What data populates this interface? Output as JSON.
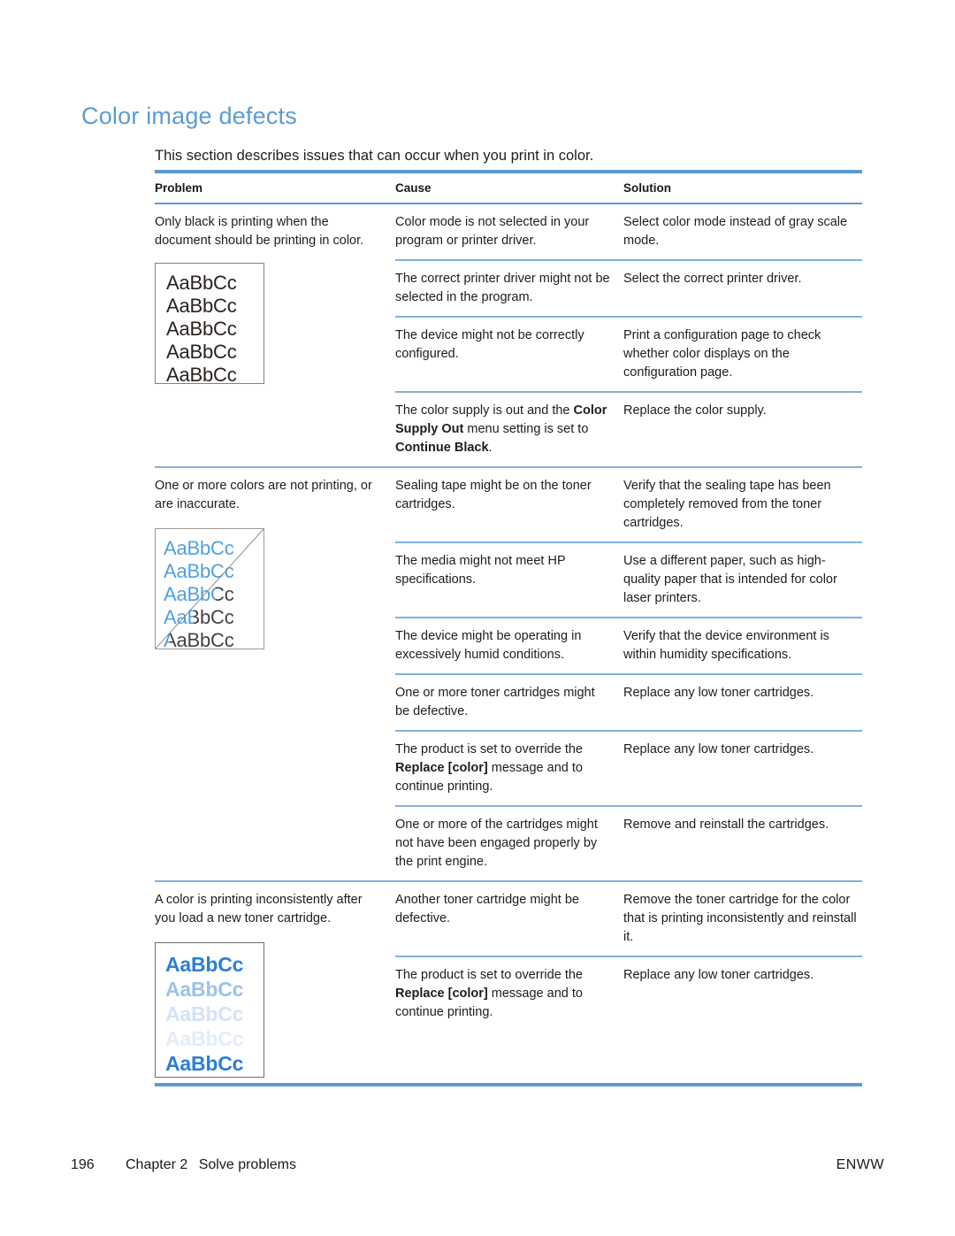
{
  "heading": "Color image defects",
  "intro": "This section describes issues that can occur when you print in color.",
  "colors": {
    "heading_blue": "#5B9BD5",
    "rule_blue": "#7FB2E0",
    "sample_blue": "#4d9fe0",
    "sample_dark": "#46403e"
  },
  "table": {
    "headers": {
      "problem": "Problem",
      "cause": "Cause",
      "solution": "Solution"
    },
    "groups": [
      {
        "problem": "Only black is printing when the document should be printing in color.",
        "sample": {
          "type": "mono-black",
          "lines": [
            "AaBbCc",
            "AaBbCc",
            "AaBbCc",
            "AaBbCc",
            "AaBbCc"
          ]
        },
        "rows": [
          {
            "cause_pre": "Color mode is not selected in your program or printer driver.",
            "cause_bold": "",
            "cause_post": "",
            "solution": "Select color mode instead of gray scale mode."
          },
          {
            "cause_pre": "The correct printer driver might not be selected in the program.",
            "cause_bold": "",
            "cause_post": "",
            "solution": "Select the correct printer driver."
          },
          {
            "cause_pre": "The device might not be correctly configured.",
            "cause_bold": "",
            "cause_post": "",
            "solution": "Print a configuration page to check whether color displays on the configuration page."
          },
          {
            "cause_pre": "The color supply is out and the ",
            "cause_bold": "Color Supply Out",
            "cause_post": " menu setting is set to ",
            "cause_bold2": "Continue Black",
            "cause_post2": ".",
            "solution": "Replace the color supply."
          }
        ]
      },
      {
        "problem": "One or more colors are not printing, or are inaccurate.",
        "sample": {
          "type": "diagonal-split",
          "lines": [
            "AaBbCc",
            "AaBbCc",
            "AaBbCc",
            "AaBbCc",
            "AaBbCc"
          ],
          "split_percents": [
            "96%",
            "74%",
            "52%",
            "30%",
            "6%"
          ]
        },
        "rows": [
          {
            "cause_pre": "Sealing tape might be on the toner cartridges.",
            "cause_bold": "",
            "cause_post": "",
            "solution": "Verify that the sealing tape has been completely removed from the toner cartridges."
          },
          {
            "cause_pre": "The media might not meet HP specifications.",
            "cause_bold": "",
            "cause_post": "",
            "solution": "Use a different paper, such as high-quality paper that is intended for color laser printers."
          },
          {
            "cause_pre": "The device might be operating in excessively humid conditions.",
            "cause_bold": "",
            "cause_post": "",
            "solution": "Verify that the device environment is within humidity specifications."
          },
          {
            "cause_pre": "One or more toner cartridges might be defective.",
            "cause_bold": "",
            "cause_post": "",
            "solution": "Replace any low toner cartridges."
          },
          {
            "cause_pre": "The product is set to override the ",
            "cause_bold": "Replace [color]",
            "cause_post": " message and to continue printing.",
            "solution": "Replace any low toner cartridges."
          },
          {
            "cause_pre": "One or more of the cartridges might not have been engaged properly by the print engine.",
            "cause_bold": "",
            "cause_post": "",
            "solution": "Remove and reinstall the cartridges."
          }
        ]
      },
      {
        "problem": "A color is printing inconsistently after you load a new toner cartridge.",
        "sample": {
          "type": "fading-blue",
          "lines": [
            "AaBbCc",
            "AaBbCc",
            "AaBbCc",
            "AaBbCc",
            "AaBbCc"
          ],
          "line_colors": [
            "#2b7fd4",
            "#9cc3e8",
            "#d3e3f5",
            "#e2edf9",
            "#2b7fd4"
          ]
        },
        "rows": [
          {
            "cause_pre": "Another toner cartridge might be defective.",
            "cause_bold": "",
            "cause_post": "",
            "solution": "Remove the toner cartridge for the color that is printing inconsistently and reinstall it."
          },
          {
            "cause_pre": "The product is set to override the ",
            "cause_bold": "Replace [color]",
            "cause_post": " message and to continue printing.",
            "solution": "Replace any low toner cartridges."
          }
        ]
      }
    ]
  },
  "footer": {
    "page_number": "196",
    "chapter_label": "Chapter 2",
    "chapter_title": "Solve problems",
    "locale": "ENWW"
  }
}
